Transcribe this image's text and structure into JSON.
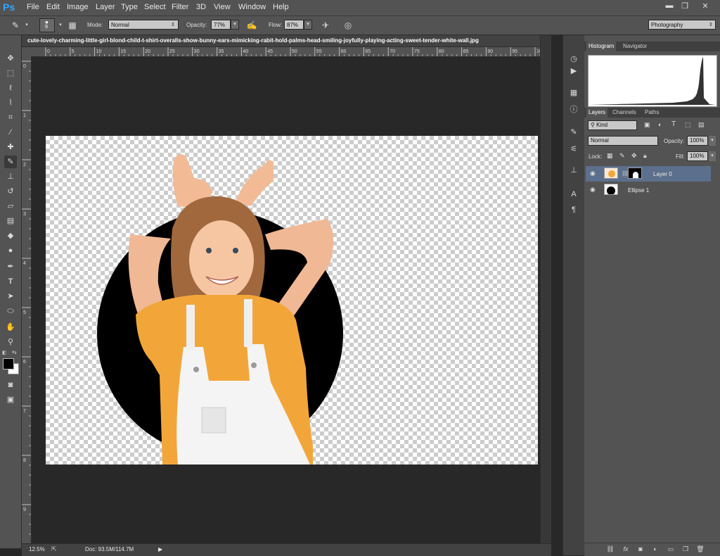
{
  "app": {
    "logo": "Ps"
  },
  "menu": [
    "File",
    "Edit",
    "Image",
    "Layer",
    "Type",
    "Select",
    "Filter",
    "3D",
    "View",
    "Window",
    "Help"
  ],
  "window_controls": {
    "minimize": "▬",
    "restore": "❐",
    "close": "✕"
  },
  "options": {
    "brush_size": "9",
    "mode_label": "Mode:",
    "mode_value": "Normal",
    "opacity_label": "Opacity:",
    "opacity_value": "77%",
    "flow_label": "Flow:",
    "flow_value": "87%",
    "workspace": "Photography"
  },
  "document": {
    "title": "cute-lovely-charming-little-girl-blond-child-t-shirt-overalls-show-bunny-ears-mimicking-rabit-hold-palms-head-smiling-joyfully-playing-acting-sweet-tender-white-wall.jpg",
    "ruler_h": [
      "0",
      "5",
      "10",
      "15",
      "20",
      "25",
      "30",
      "35",
      "40",
      "45",
      "50",
      "55",
      "60",
      "65",
      "70",
      "75",
      "80",
      "85",
      "90",
      "95",
      "100"
    ],
    "ruler_v": [
      "0",
      "1",
      "2",
      "3",
      "4",
      "5",
      "6",
      "7",
      "8",
      "9"
    ]
  },
  "status": {
    "zoom": "12.5%",
    "doc": "Doc: 93.5M/114.7M"
  },
  "panels": {
    "top_tabs": [
      "Histogram",
      "Navigator"
    ],
    "layers_tabs": [
      "Layers",
      "Channels",
      "Paths"
    ],
    "filter_kind": "Kind",
    "blend_mode": "Normal",
    "opacity_label": "Opacity:",
    "opacity_value": "100%",
    "lock_label": "Lock:",
    "fill_label": "Fill:",
    "fill_value": "100%",
    "layers": [
      {
        "name": "Layer 0",
        "selected": true
      },
      {
        "name": "Ellipse 1",
        "selected": false
      }
    ]
  },
  "colors": {
    "chrome": "#535353",
    "dark": "#282828",
    "selected_layer": "#5c6f8c",
    "accent": "#31a8ff"
  }
}
